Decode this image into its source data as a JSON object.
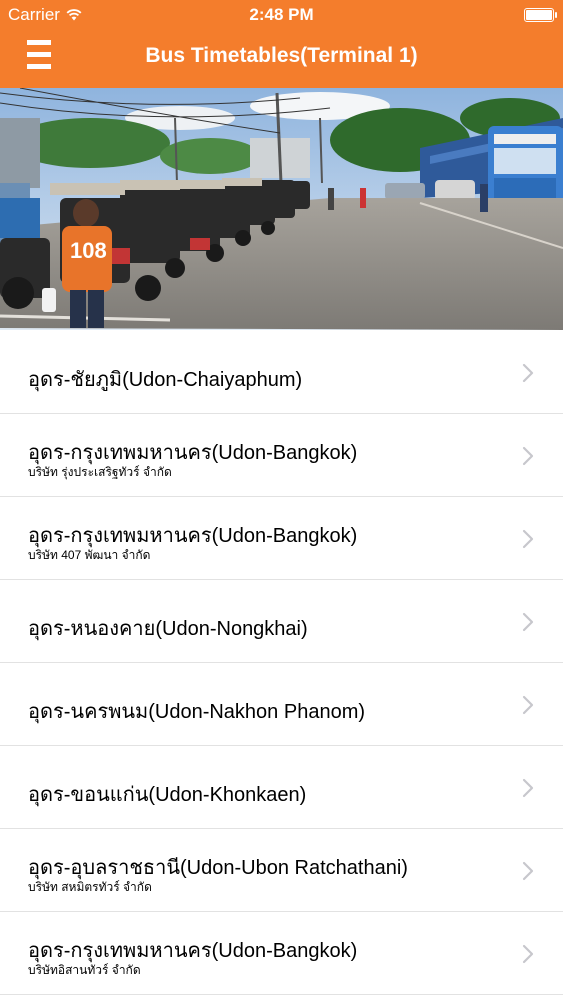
{
  "status_bar": {
    "carrier": "Carrier",
    "time": "2:48 PM"
  },
  "nav": {
    "title": "Bus Timetables(Terminal 1)",
    "menu_icon": "hamburger-menu-icon"
  },
  "colors": {
    "accent": "#f47d2c",
    "separator": "#e2e2e2",
    "chevron": "#c7c7cc"
  },
  "routes": [
    {
      "title": "อุดร-ชัยภูมิ(Udon-Chaiyaphum)",
      "subtitle": ""
    },
    {
      "title": "อุดร-กรุงเทพมหานคร(Udon-Bangkok)",
      "subtitle": "บริษัท รุ่งประเสริฐทัวร์ จำกัด"
    },
    {
      "title": "อุดร-กรุงเทพมหานคร(Udon-Bangkok)",
      "subtitle": "บริษัท 407 พัฒนา จำกัด"
    },
    {
      "title": "อุดร-หนองคาย(Udon-Nongkhai)",
      "subtitle": ""
    },
    {
      "title": "อุดร-นครพนม(Udon-Nakhon Phanom)",
      "subtitle": ""
    },
    {
      "title": "อุดร-ขอนแก่น(Udon-Khonkaen)",
      "subtitle": ""
    },
    {
      "title": "อุดร-อุบลราชธานี(Udon-Ubon Ratchathani)",
      "subtitle": "บริษัท สหมิตรทัวร์ จำกัด"
    },
    {
      "title": "อุดร-กรุงเทพมหานคร(Udon-Bangkok)",
      "subtitle": "บริษัทอิสานทัวร์ จำกัด"
    }
  ]
}
